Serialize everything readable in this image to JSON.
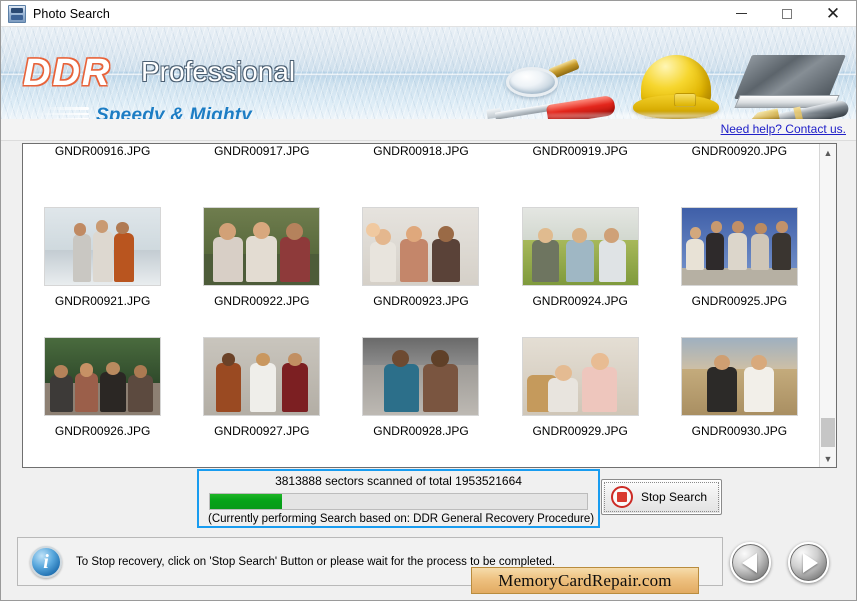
{
  "window": {
    "title": "Photo Search",
    "app_icon": "photo-search-app-icon",
    "minimize_label": "Minimize",
    "maximize_label": "Maximize",
    "close_label": "Close"
  },
  "banner": {
    "brand_main": "DDR",
    "brand_sub": "Professional",
    "tagline": "Speedy & Mighty",
    "accent_orange": "#e8633a",
    "accent_blue": "#1d7dc4",
    "icons": [
      "magnifier-icon",
      "hard-hat-icon",
      "book-icon",
      "screwdriver-icon",
      "pen-icon"
    ]
  },
  "help": {
    "link_text": "Need help? Contact us.",
    "link_color": "#2020c8"
  },
  "file_list": {
    "rows": [
      {
        "type": "labels",
        "cells": [
          {
            "name": "GNDR00916.JPG"
          },
          {
            "name": "GNDR00917.JPG"
          },
          {
            "name": "GNDR00918.JPG"
          },
          {
            "name": "GNDR00919.JPG"
          },
          {
            "name": "GNDR00920.JPG"
          }
        ]
      },
      {
        "type": "thumbs",
        "cells": [
          {
            "name": "GNDR00921.JPG",
            "thumb": "three-women-beach-photo"
          },
          {
            "name": "GNDR00922.JPG",
            "thumb": "three-women-smiling-photo"
          },
          {
            "name": "GNDR00923.JPG",
            "thumb": "group-waving-photo"
          },
          {
            "name": "GNDR00924.JPG",
            "thumb": "friends-picnic-grass-photo"
          },
          {
            "name": "GNDR00925.JPG",
            "thumb": "group-sitting-wall-photo"
          }
        ]
      },
      {
        "type": "thumbs",
        "cells": [
          {
            "name": "GNDR00926.JPG",
            "thumb": "friends-outdoor-party-photo"
          },
          {
            "name": "GNDR00927.JPG",
            "thumb": "three-friends-street-photo"
          },
          {
            "name": "GNDR00928.JPG",
            "thumb": "two-women-sitting-road-photo"
          },
          {
            "name": "GNDR00929.JPG",
            "thumb": "children-kitchen-photo"
          },
          {
            "name": "GNDR00930.JPG",
            "thumb": "two-women-field-photo"
          }
        ]
      }
    ],
    "scrollbar": {
      "up_arrow": "chevron-up-icon",
      "down_arrow": "chevron-down-icon"
    }
  },
  "progress": {
    "status_text": "3813888 sectors scanned of total 1953521664",
    "sectors_scanned": 3813888,
    "sectors_total": 1953521664,
    "percent": 19,
    "sub_text": "(Currently performing Search based on:  DDR General Recovery Procedure)",
    "bar_color": "#06a318",
    "border_color": "#189cf0"
  },
  "stop_button": {
    "label": "Stop Search",
    "icon": "stop-square-icon"
  },
  "status_bar": {
    "icon": "info-icon",
    "message": "To Stop recovery, click on 'Stop Search' Button or please wait for the process to be completed."
  },
  "brand_badge": {
    "text": "MemoryCardRepair.com"
  },
  "nav": {
    "prev_label": "Back",
    "next_label": "Next",
    "prev_icon": "arrow-left-icon",
    "next_icon": "arrow-right-icon"
  }
}
